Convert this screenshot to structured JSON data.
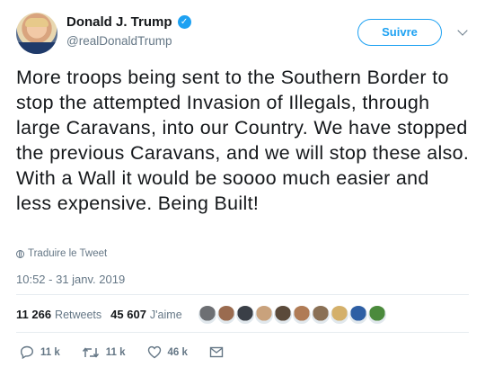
{
  "author": {
    "name": "Donald J. Trump",
    "handle": "@realDonaldTrump"
  },
  "follow_label": "Suivre",
  "tweet": {
    "text": "More troops being sent to the Southern Border to stop the attempted Invasion of Illegals, through large Caravans, into our Country. We have stopped the previous Caravans, and we will stop these also. With a Wall it would be soooo much easier and less expensive. Being Built!",
    "translate_label": "Traduire le Tweet",
    "timestamp": "10:52 - 31 janv. 2019"
  },
  "stats": {
    "retweets_count": "11 266",
    "retweets_label": "Retweets",
    "likes_count": "45 607",
    "likes_label": "J'aime"
  },
  "likers": [
    {
      "color": "#6d6f73"
    },
    {
      "color": "#9a6b4f"
    },
    {
      "color": "#3a3f47"
    },
    {
      "color": "#c9a27c"
    },
    {
      "color": "#5b4a3a"
    },
    {
      "color": "#b07b55"
    },
    {
      "color": "#8a7055"
    },
    {
      "color": "#d4b06a"
    },
    {
      "color": "#2e5fa4"
    },
    {
      "color": "#4b8a3c"
    }
  ],
  "actions": {
    "replies": "11 k",
    "retweets": "11 k",
    "likes": "46 k"
  },
  "colors": {
    "accent": "#1da1f2",
    "muted": "#657786",
    "text": "#14171a"
  }
}
